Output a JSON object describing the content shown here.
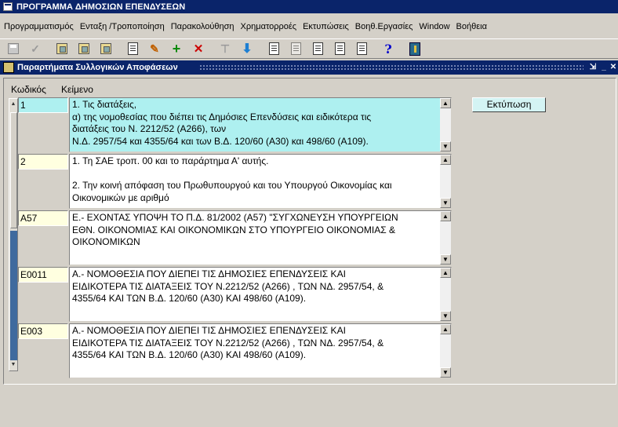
{
  "app": {
    "title": "ΠΡΟΓΡΑΜΜΑ ΔΗΜΟΣΙΩΝ ΕΠΕΝΔΥΣΕΩΝ"
  },
  "menu": [
    "Προγραμματισμός",
    "Ενταξη /Τροποποίηση",
    "Παρακολούθηση",
    "Χρηματορροές",
    "Εκτυπώσεις",
    "Βοηθ.Εργασίες",
    "Window",
    "Βοήθεια"
  ],
  "window": {
    "title": "Παραρτήματα Συλλογικών Αποφάσεων"
  },
  "columns": {
    "code": "Κωδικός",
    "text": "Κείμενο"
  },
  "print_button": "Εκτύπωση",
  "records": [
    {
      "code": "1",
      "lines": [
        "1. Τις διατάξεις,",
        "    α) της νομοθεσίας που διέπει  τις Δημόσιες Επενδύσεις και ειδικότερα τις",
        "    διατάξεις του Ν. 2212/52 (Α266), των",
        "            Ν.Δ. 2957/54 και 4355/64 και των Β.Δ. 120/60 (Α30) και 498/60 (Α109)."
      ]
    },
    {
      "code": "2",
      "lines": [
        "1. Τη ΣΑΕ      τροπ. 00 και το παράρτημα Α' αυτής.",
        "",
        "2. Την κοινή απόφαση του Πρωθυπουργού και του Υπουργού Οικονομίας και",
        "Οικονομικών με αριθμό"
      ]
    },
    {
      "code": "Α57",
      "lines": [
        "Ε.- ΕΧΟΝΤΑΣ ΥΠΟΨΗ ΤΟ Π.Δ. 81/2002 (Α57) \"ΣΥΓΧΩΝΕΥΣΗ ΥΠΟΥΡΓΕΙΩΝ",
        "ΕΘΝ. ΟΙΚΟΝΟΜΙΑΣ ΚΑΙ ΟΙΚΟΝΟΜΙΚΩΝ ΣΤΟ ΥΠΟΥΡΓΕΙΟ ΟΙΚΟΝΟΜΙΑΣ &",
        "ΟΙΚΟΝΟΜΙΚΩΝ"
      ]
    },
    {
      "code": "Ε0011",
      "lines": [
        "Α.- ΝΟΜΟΘΕΣΙΑ ΠΟΥ ΔΙΕΠΕΙ ΤΙΣ ΔΗΜΟΣΙΕΣ ΕΠΕΝΔΥΣΕΙΣ ΚΑΙ",
        "ΕΙΔΙΚΟΤΕΡΑ ΤΙΣ ΔΙΑΤΑΞΕΙΣ ΤΟΥ Ν.2212/52 (Α266) , ΤΩΝ ΝΔ. 2957/54, &",
        "4355/64 ΚΑΙ ΤΩΝ Β.Δ. 120/60 (Α30) ΚΑΙ 498/60 (Α109)."
      ]
    },
    {
      "code": "Ε003",
      "lines": [
        "Α.- ΝΟΜΟΘΕΣΙΑ ΠΟΥ ΔΙΕΠΕΙ ΤΙΣ ΔΗΜΟΣΙΕΣ ΕΠΕΝΔΥΣΕΙΣ ΚΑΙ",
        "ΕΙΔΙΚΟΤΕΡΑ ΤΙΣ ΔΙΑΤΑΞΕΙΣ ΤΟΥ Ν.2212/52 (Α266) , ΤΩΝ ΝΔ. 2957/54, &",
        "4355/64 ΚΑΙ ΤΩΝ Β.Δ. 120/60 (Α30) ΚΑΙ 498/60 (Α109)."
      ]
    }
  ]
}
